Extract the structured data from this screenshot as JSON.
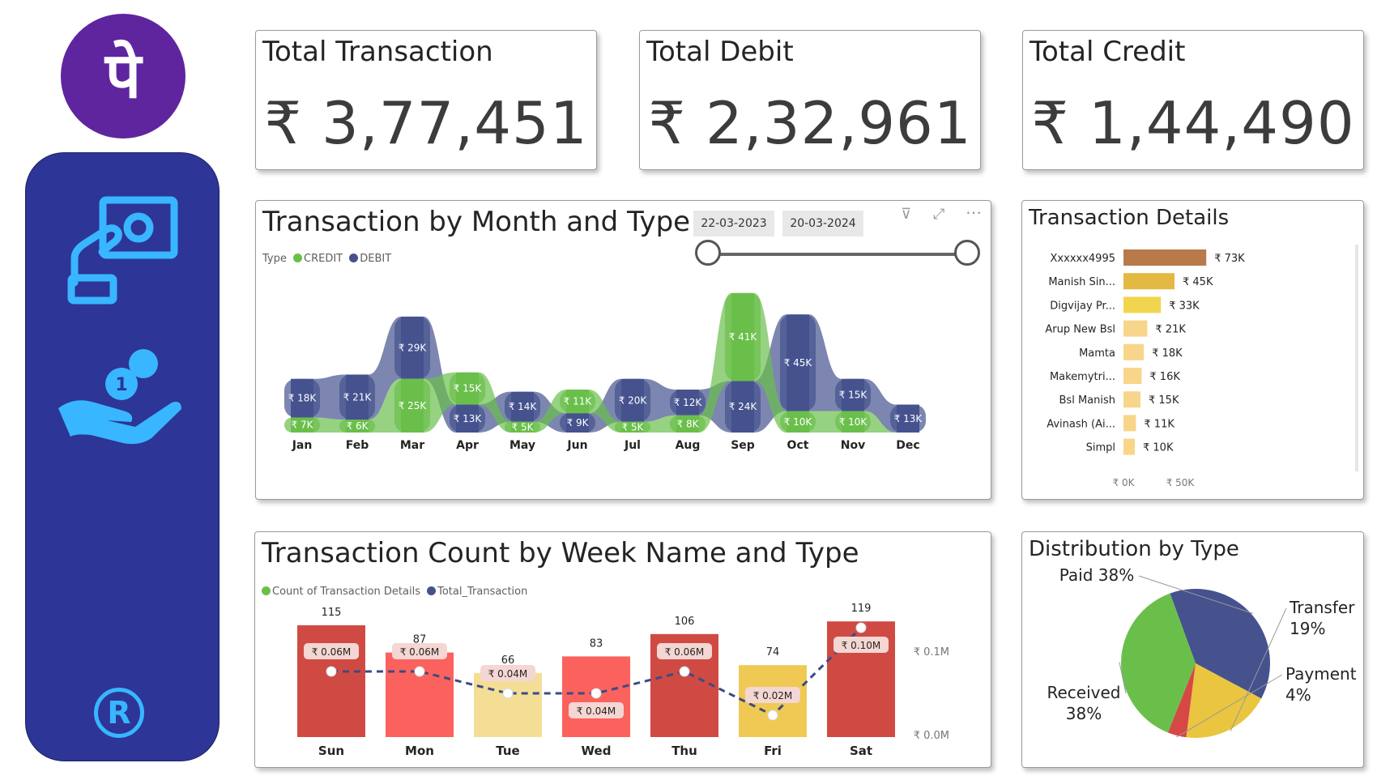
{
  "brand": {
    "logo_glyph": "पे",
    "logo_color": "#5f259f",
    "sidebar_color": "#2d3596",
    "icon_color": "#38b6ff",
    "registered_glyph": "R"
  },
  "kpis": [
    {
      "title": "Total Transaction",
      "value": "₹ 3,77,451"
    },
    {
      "title": "Total Debit",
      "value": "₹ 2,32,961"
    },
    {
      "title": "Total Credit",
      "value": "₹ 1,44,490"
    }
  ],
  "ribbon": {
    "title": "Transaction by Month and Type",
    "date_from": "22-03-2023",
    "date_to": "20-03-2024",
    "legend_label": "Type",
    "colors": {
      "CREDIT": "#6abf4b",
      "DEBIT": "#45528e"
    }
  },
  "details": {
    "title": "Transaction Details"
  },
  "week": {
    "title": "Transaction Count by Week Name and Type",
    "y2_ticks": [
      "₹ 0.1M",
      "₹ 0.0M"
    ]
  },
  "pie": {
    "title": "Distribution by Type"
  },
  "chart_data": [
    {
      "type": "area",
      "title": "Transaction by Month and Type",
      "categories": [
        "Jan",
        "Feb",
        "Mar",
        "Apr",
        "May",
        "Jun",
        "Jul",
        "Aug",
        "Sep",
        "Oct",
        "Nov",
        "Dec"
      ],
      "legend": "top-left",
      "series": [
        {
          "name": "CREDIT",
          "values": [
            7,
            6,
            25,
            15,
            5,
            11,
            5,
            8,
            41,
            10,
            10,
            0
          ],
          "labels": [
            "₹ 7K",
            "₹ 6K",
            "₹ 25K",
            "₹ 15K",
            "₹ 5K",
            "₹ 11K",
            "₹ 5K",
            "₹ 8K",
            "₹ 41K",
            "₹ 10K",
            "₹ 10K",
            ""
          ]
        },
        {
          "name": "DEBIT",
          "values": [
            18,
            21,
            29,
            13,
            14,
            9,
            20,
            12,
            24,
            45,
            15,
            13
          ],
          "labels": [
            "₹ 18K",
            "₹ 21K",
            "₹ 29K",
            "₹ 13K",
            "₹ 14K",
            "₹ 9K",
            "₹ 20K",
            "₹ 12K",
            "₹ 24K",
            "₹ 45K",
            "₹ 15K",
            "₹ 13K"
          ]
        }
      ]
    },
    {
      "type": "bar",
      "title": "Transaction Details",
      "categories": [
        "Xxxxxx4995",
        "Manish Sin...",
        "Digvijay Pr...",
        "Arup New Bsl",
        "Mamta",
        "Makemytri...",
        "Bsl Manish",
        "Avinash (Ai...",
        "Simpl"
      ],
      "values": [
        73,
        45,
        33,
        21,
        18,
        16,
        15,
        11,
        10
      ],
      "labels": [
        "₹ 73K",
        "₹ 45K",
        "₹ 33K",
        "₹ 21K",
        "₹ 18K",
        "₹ 16K",
        "₹ 15K",
        "₹ 11K",
        "₹ 10K"
      ],
      "colors": [
        "#b87a4b",
        "#e3b843",
        "#f1d54e",
        "#f7d58a",
        "#f7d58a",
        "#f7d58a",
        "#f7d58a",
        "#f7d58a",
        "#f7d58a"
      ],
      "xticks": [
        "₹ 0K",
        "₹ 50K"
      ],
      "xlim": [
        0,
        100
      ]
    },
    {
      "type": "bar",
      "title": "Transaction Count by Week Name and Type",
      "categories": [
        "Sun",
        "Mon",
        "Tue",
        "Wed",
        "Thu",
        "Fri",
        "Sat"
      ],
      "legend": "top-left",
      "series": [
        {
          "name": "Count of Transaction Details",
          "values": [
            115,
            87,
            66,
            83,
            106,
            74,
            119
          ],
          "colors": [
            "#d04a44",
            "#fb625d",
            "#f4de96",
            "#fb625d",
            "#d04a44",
            "#efc954",
            "#d04a44"
          ]
        },
        {
          "name": "Total_Transaction",
          "values": [
            0.06,
            0.06,
            0.04,
            0.04,
            0.06,
            0.02,
            0.1
          ],
          "labels": [
            "₹ 0.06M",
            "₹ 0.06M",
            "₹ 0.04M",
            "₹ 0.04M",
            "₹ 0.06M",
            "₹ 0.02M",
            "₹ 0.10M"
          ]
        }
      ],
      "y2ticks": [
        "₹ 0.1M",
        "₹ 0.0M"
      ]
    },
    {
      "type": "pie",
      "title": "Distribution by Type",
      "slices": [
        {
          "name": "Paid",
          "value": 38,
          "color": "#45528e",
          "label": [
            "Paid 38%"
          ]
        },
        {
          "name": "Transfer",
          "value": 19,
          "color": "#eac53f",
          "label": [
            "Transfer",
            "19%"
          ]
        },
        {
          "name": "Payment",
          "value": 4,
          "color": "#d64845",
          "label": [
            "Payment",
            "4%"
          ]
        },
        {
          "name": "Received",
          "value": 38,
          "color": "#6abf4b",
          "label": [
            "Received",
            "38%"
          ]
        }
      ]
    }
  ]
}
